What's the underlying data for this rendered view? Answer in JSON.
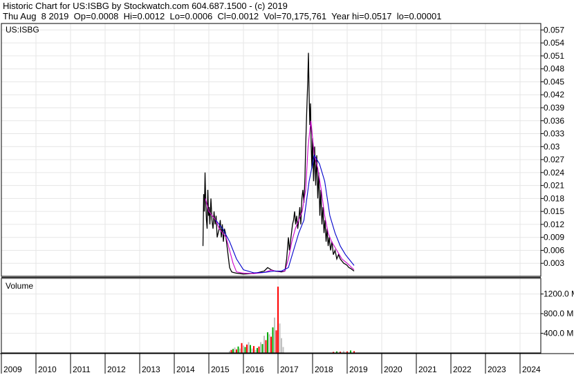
{
  "header": {
    "title": "Historic Chart for US:ISBG by Stockwatch.com 604.687.1500 - (c) 2019",
    "date": "Thu Aug  8 2019",
    "open": "Op=0.0008",
    "high": "Hi=0.0012",
    "low": "Lo=0.0006",
    "close": "Cl=0.0012",
    "volume": "Vol=70,175,761",
    "year_high": "Year hi=0.0517",
    "year_low": "lo=0.00001"
  },
  "chart_data": [
    {
      "type": "line",
      "symbol_label": "US:ISBG",
      "y_ticks": [
        "0.057",
        "0.054",
        "0.051",
        "0.048",
        "0.045",
        "0.042",
        "0.039",
        "0.036",
        "0.033",
        "0.03",
        "0.027",
        "0.024",
        "0.021",
        "0.018",
        "0.015",
        "0.012",
        "0.009",
        "0.006",
        "0.003"
      ],
      "ylim": [
        0,
        0.0585
      ],
      "xlim": [
        2009,
        2024.6
      ],
      "x_ticks": [
        "2009",
        "2010",
        "2011",
        "2012",
        "2013",
        "2014",
        "2015",
        "2016",
        "2017",
        "2018",
        "2019",
        "2020",
        "2021",
        "2022",
        "2023",
        "2024"
      ],
      "grid": true,
      "series": [
        {
          "color": "#000000",
          "x": [
            2014.83,
            2014.85,
            2014.87,
            2014.89,
            2014.91,
            2014.93,
            2014.95,
            2014.97,
            2014.99,
            2015.01,
            2015.03,
            2015.06,
            2015.09,
            2015.12,
            2015.15,
            2015.18,
            2015.21,
            2015.24,
            2015.27,
            2015.3,
            2015.33,
            2015.36,
            2015.39,
            2015.42,
            2015.45,
            2015.48,
            2015.51,
            2015.54,
            2015.57,
            2015.6,
            2015.63,
            2015.66,
            2015.7,
            2015.75,
            2015.8,
            2015.9,
            2016.0,
            2016.2,
            2016.4,
            2016.6,
            2016.7,
            2016.8,
            2016.9,
            2017.0,
            2017.1,
            2017.2,
            2017.25,
            2017.28,
            2017.3,
            2017.33,
            2017.36,
            2017.39,
            2017.42,
            2017.45,
            2017.48,
            2017.51,
            2017.54,
            2017.57,
            2017.6,
            2017.63,
            2017.66,
            2017.69,
            2017.72,
            2017.75,
            2017.78,
            2017.8,
            2017.83,
            2017.86,
            2017.88,
            2017.9,
            2017.92,
            2017.94,
            2017.96,
            2017.98,
            2018.0,
            2018.03,
            2018.06,
            2018.09,
            2018.12,
            2018.15,
            2018.18,
            2018.21,
            2018.24,
            2018.27,
            2018.3,
            2018.33,
            2018.36,
            2018.39,
            2018.42,
            2018.45,
            2018.48,
            2018.52,
            2018.56,
            2018.6,
            2018.65,
            2018.7,
            2018.75,
            2018.8,
            2018.85,
            2018.9,
            2018.95,
            2019.0,
            2019.05,
            2019.1,
            2019.15,
            2019.2
          ],
          "values": [
            0.007,
            0.019,
            0.015,
            0.024,
            0.017,
            0.013,
            0.011,
            0.02,
            0.014,
            0.016,
            0.012,
            0.018,
            0.013,
            0.011,
            0.015,
            0.012,
            0.014,
            0.009,
            0.01,
            0.011,
            0.013,
            0.009,
            0.012,
            0.008,
            0.011,
            0.01,
            0.008,
            0.006,
            0.004,
            0.002,
            0.0015,
            0.001,
            0.0009,
            0.0008,
            0.0007,
            0.0006,
            0.0005,
            0.0006,
            0.0008,
            0.0012,
            0.002,
            0.0015,
            0.0012,
            0.0011,
            0.001,
            0.0012,
            0.004,
            0.007,
            0.009,
            0.006,
            0.008,
            0.01,
            0.012,
            0.013,
            0.015,
            0.012,
            0.014,
            0.011,
            0.013,
            0.016,
            0.012,
            0.018,
            0.02,
            0.017,
            0.023,
            0.03,
            0.038,
            0.045,
            0.0517,
            0.042,
            0.035,
            0.04,
            0.03,
            0.025,
            0.032,
            0.022,
            0.03,
            0.021,
            0.028,
            0.018,
            0.024,
            0.014,
            0.02,
            0.012,
            0.016,
            0.01,
            0.013,
            0.008,
            0.011,
            0.007,
            0.009,
            0.006,
            0.008,
            0.005,
            0.006,
            0.004,
            0.005,
            0.004,
            0.0035,
            0.003,
            0.0028,
            0.0025,
            0.002,
            0.0018,
            0.0015,
            0.0012
          ]
        },
        {
          "color": "#cc00cc",
          "x": [
            2014.9,
            2015.0,
            2015.1,
            2015.2,
            2015.3,
            2015.4,
            2015.5,
            2015.6,
            2015.7,
            2015.8,
            2016.0,
            2016.3,
            2016.6,
            2016.8,
            2017.0,
            2017.2,
            2017.3,
            2017.4,
            2017.5,
            2017.6,
            2017.7,
            2017.8,
            2017.87,
            2017.95,
            2018.05,
            2018.15,
            2018.25,
            2018.35,
            2018.45,
            2018.55,
            2018.7,
            2018.85,
            2019.0,
            2019.2
          ],
          "values": [
            0.018,
            0.015,
            0.014,
            0.013,
            0.011,
            0.01,
            0.009,
            0.006,
            0.003,
            0.001,
            0.0007,
            0.0006,
            0.0009,
            0.0014,
            0.0011,
            0.0012,
            0.004,
            0.008,
            0.011,
            0.013,
            0.015,
            0.02,
            0.03,
            0.036,
            0.028,
            0.025,
            0.02,
            0.014,
            0.01,
            0.008,
            0.006,
            0.004,
            0.003,
            0.0015
          ]
        },
        {
          "color": "#0000cc",
          "x": [
            2015.2,
            2015.4,
            2015.6,
            2015.8,
            2016.0,
            2016.3,
            2016.6,
            2016.9,
            2017.1,
            2017.3,
            2017.45,
            2017.6,
            2017.75,
            2017.9,
            2018.05,
            2018.2,
            2018.35,
            2018.5,
            2018.65,
            2018.8,
            2018.95,
            2019.1,
            2019.2
          ],
          "values": [
            0.013,
            0.011,
            0.008,
            0.004,
            0.0015,
            0.0008,
            0.0009,
            0.0012,
            0.0012,
            0.002,
            0.006,
            0.01,
            0.013,
            0.022,
            0.028,
            0.026,
            0.022,
            0.014,
            0.01,
            0.007,
            0.005,
            0.0035,
            0.0025
          ]
        }
      ]
    },
    {
      "type": "bar",
      "title": "Volume",
      "y_ticks": [
        "1200.0 M",
        "800.0 M",
        "400.0 M"
      ],
      "ylim": [
        0,
        1520
      ],
      "bars": {
        "x": [
          2015.6,
          2015.65,
          2015.7,
          2015.75,
          2015.8,
          2015.85,
          2015.9,
          2015.95,
          2016.0,
          2016.05,
          2016.1,
          2016.15,
          2016.2,
          2016.25,
          2016.3,
          2016.35,
          2016.4,
          2016.45,
          2016.5,
          2016.55,
          2016.6,
          2016.65,
          2016.7,
          2016.75,
          2016.8,
          2016.85,
          2016.9,
          2016.95,
          2017.0,
          2017.05,
          2017.1,
          2017.15,
          2018.6,
          2018.7,
          2018.8,
          2018.9,
          2019.0,
          2019.1,
          2019.2
        ],
        "values": [
          40,
          60,
          80,
          110,
          70,
          130,
          90,
          200,
          150,
          120,
          170,
          220,
          160,
          90,
          140,
          60,
          100,
          130,
          220,
          180,
          350,
          260,
          420,
          380,
          330,
          520,
          720,
          460,
          1350,
          600,
          300,
          120,
          20,
          30,
          25,
          40,
          30,
          50,
          35
        ],
        "colors": [
          "#c0c0c0",
          "#ff0000",
          "#00aa00",
          "#c0c0c0",
          "#ff0000",
          "#00aa00",
          "#c0c0c0",
          "#ff0000",
          "#c0c0c0",
          "#00aa00",
          "#ff0000",
          "#c0c0c0",
          "#00aa00",
          "#c0c0c0",
          "#ff0000",
          "#c0c0c0",
          "#00aa00",
          "#ff0000",
          "#c0c0c0",
          "#00aa00",
          "#c0c0c0",
          "#ff0000",
          "#00aa00",
          "#c0c0c0",
          "#ff0000",
          "#00aa00",
          "#c0c0c0",
          "#ff0000",
          "#ff0000",
          "#c0c0c0",
          "#c0c0c0",
          "#c0c0c0",
          "#ff0000",
          "#00aa00",
          "#ff0000",
          "#c0c0c0",
          "#ff0000",
          "#00aa00",
          "#ff0000"
        ]
      }
    }
  ]
}
